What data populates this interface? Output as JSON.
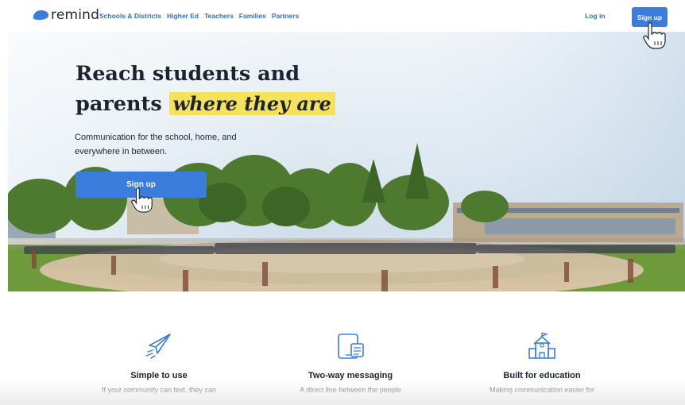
{
  "brand": {
    "logo_text": "remind",
    "color": "#3b7ddd"
  },
  "nav": {
    "items": [
      {
        "label": "Schools & Districts"
      },
      {
        "label": "Higher Ed"
      },
      {
        "label": "Teachers"
      },
      {
        "label": "Families"
      },
      {
        "label": "Partners"
      }
    ],
    "login_label": "Log in",
    "signup_label": "Sign up"
  },
  "hero": {
    "headline_line1": "Reach students and",
    "headline_line2_prefix": "parents",
    "headline_highlight": "where they are",
    "subtitle": "Communication for the school, home, and everywhere in between.",
    "cta_label": "Sign up",
    "highlight_color": "#f6e25a"
  },
  "features": [
    {
      "icon": "paper-plane-icon",
      "title": "Simple to use",
      "description": "If your community can text, they can"
    },
    {
      "icon": "tablet-chat-icon",
      "title": "Two-way messaging",
      "description": "A direct line between the people"
    },
    {
      "icon": "school-building-icon",
      "title": "Built for education",
      "description": "Making communication easier for"
    }
  ]
}
